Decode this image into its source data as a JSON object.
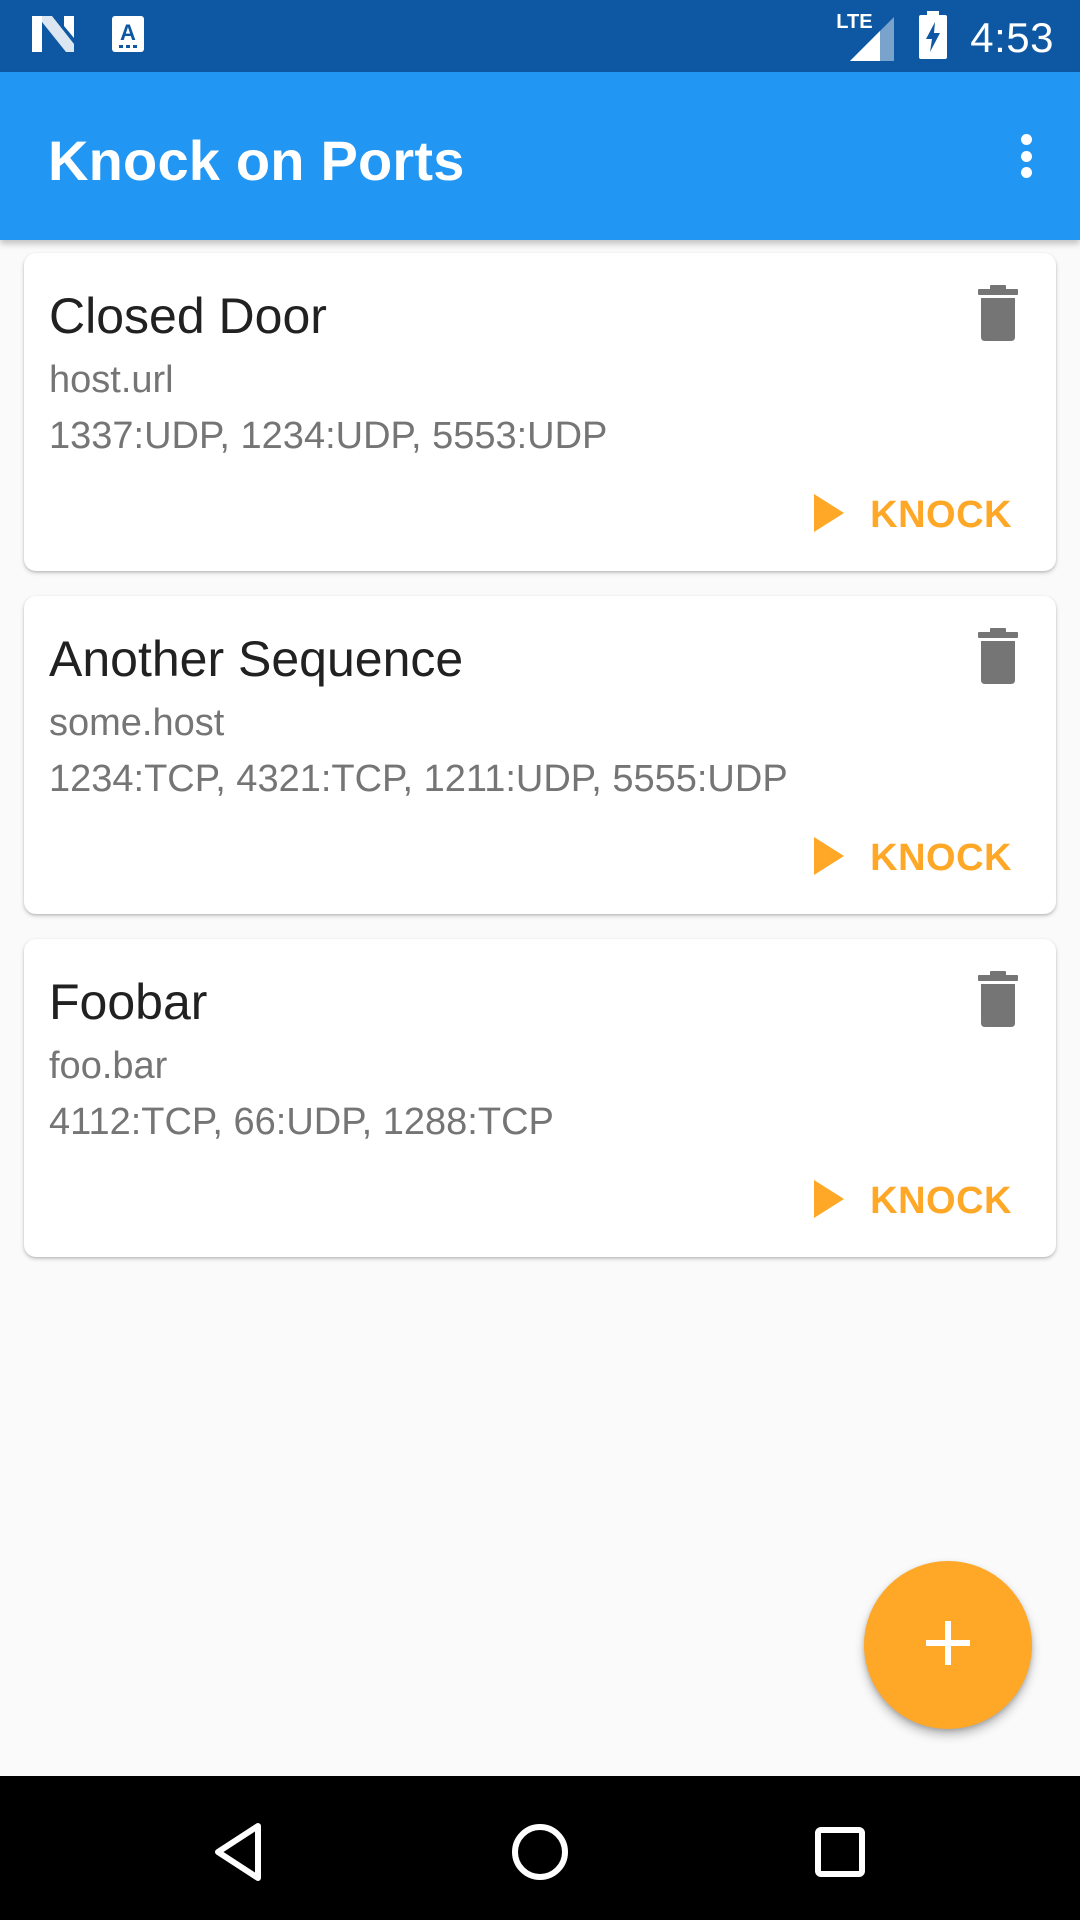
{
  "status_bar": {
    "time": "4:53",
    "network_label": "LTE",
    "icons": [
      "n-notification-icon",
      "keyboard-notification-icon",
      "lte-signal-icon",
      "battery-charging-icon"
    ]
  },
  "app_bar": {
    "title": "Knock on Ports",
    "overflow_icon": "more-vert-icon"
  },
  "sequences": [
    {
      "name": "Closed Door",
      "host": "host.url",
      "ports": "1337:UDP, 1234:UDP, 5553:UDP",
      "action_label": "KNOCK"
    },
    {
      "name": "Another Sequence",
      "host": "some.host",
      "ports": "1234:TCP, 4321:TCP, 1211:UDP, 5555:UDP",
      "action_label": "KNOCK"
    },
    {
      "name": "Foobar",
      "host": "foo.bar",
      "ports": "4112:TCP, 66:UDP, 1288:TCP",
      "action_label": "KNOCK"
    }
  ],
  "fab": {
    "icon": "plus-icon"
  },
  "nav_bar": {
    "icons": [
      "back-icon",
      "home-icon",
      "recents-icon"
    ]
  },
  "colors": {
    "status_bar": "#0E58A3",
    "primary": "#2196F3",
    "accent": "#FFA726",
    "delete_icon": "#757575"
  }
}
